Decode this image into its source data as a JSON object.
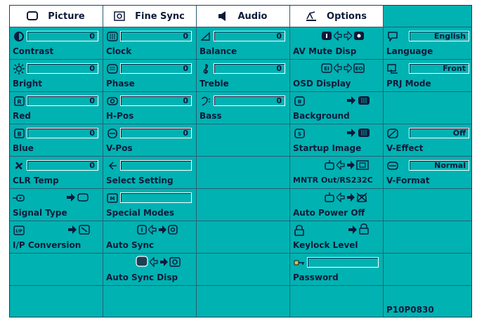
{
  "tabs": [
    {
      "label": "Picture",
      "icon": "monitor-icon"
    },
    {
      "label": "Fine Sync",
      "icon": "fine-sync-icon"
    },
    {
      "label": "Audio",
      "icon": "speaker-icon"
    },
    {
      "label": "Options",
      "icon": "options-icon"
    }
  ],
  "picture": {
    "contrast": {
      "label": "Contrast",
      "value": "0"
    },
    "bright": {
      "label": "Bright",
      "value": "0"
    },
    "red": {
      "label": "Red",
      "value": "0"
    },
    "blue": {
      "label": "Blue",
      "value": "0"
    },
    "clr_temp": {
      "label": "CLR Temp",
      "value": "0"
    },
    "signal_type": {
      "label": "Signal Type"
    },
    "ip_conversion": {
      "label": "I/P Conversion"
    }
  },
  "fine_sync": {
    "clock": {
      "label": "Clock",
      "value": "0"
    },
    "phase": {
      "label": "Phase",
      "value": "0"
    },
    "hpos": {
      "label": "H-Pos",
      "value": "0"
    },
    "vpos": {
      "label": "V-Pos",
      "value": "0"
    },
    "select_setting": {
      "label": "Select Setting",
      "value": ""
    },
    "special_modes": {
      "label": "Special Modes",
      "value": ""
    },
    "auto_sync": {
      "label": "Auto Sync"
    },
    "auto_sync_disp": {
      "label": "Auto Sync Disp"
    }
  },
  "audio": {
    "balance": {
      "label": "Balance",
      "value": "0"
    },
    "treble": {
      "label": "Treble",
      "value": "0"
    },
    "bass": {
      "label": "Bass",
      "value": "0"
    }
  },
  "options": {
    "av_mute_disp": {
      "label": "AV Mute Disp"
    },
    "osd_display": {
      "label": "OSD Display"
    },
    "background": {
      "label": "Background"
    },
    "startup_image": {
      "label": "Startup Image"
    },
    "mntr_out": {
      "label": "MNTR Out/RS232C"
    },
    "auto_power_off": {
      "label": "Auto Power Off"
    },
    "keylock_level": {
      "label": "Keylock Level"
    },
    "password": {
      "label": "Password",
      "value": ""
    }
  },
  "extra": {
    "language": {
      "label": "Language",
      "value": "English"
    },
    "prj_mode": {
      "label": "PRJ Mode",
      "value": "Front"
    },
    "v_effect": {
      "label": "V-Effect",
      "value": "Off"
    },
    "v_format": {
      "label": "V-Format",
      "value": "Normal"
    }
  },
  "footer_code": "P10P0830",
  "colors": {
    "panel": "#00b2b2",
    "text": "#0d1a3a",
    "header_bg": "#ffffff"
  }
}
